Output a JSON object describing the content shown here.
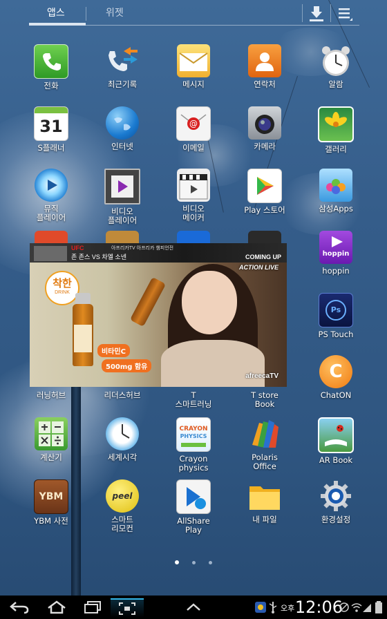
{
  "tabs": {
    "apps": "앱스",
    "widgets": "위젯"
  },
  "apps": [
    {
      "label": "전화",
      "icon": "phone-icon"
    },
    {
      "label": "최근기록",
      "icon": "call-log-icon"
    },
    {
      "label": "메시지",
      "icon": "message-icon"
    },
    {
      "label": "연락처",
      "icon": "contacts-icon"
    },
    {
      "label": "알람",
      "icon": "alarm-clock-icon"
    },
    {
      "label": "S플래너",
      "icon": "calendar-icon",
      "badge": "31"
    },
    {
      "label": "인터넷",
      "icon": "globe-icon"
    },
    {
      "label": "이메일",
      "icon": "email-icon"
    },
    {
      "label": "카메라",
      "icon": "camera-icon"
    },
    {
      "label": "갤러리",
      "icon": "gallery-icon"
    },
    {
      "label": "뮤직\n플레이어",
      "icon": "music-player-icon"
    },
    {
      "label": "비디오\n플레이어",
      "icon": "video-player-icon"
    },
    {
      "label": "비디오\n메이커",
      "icon": "video-maker-icon"
    },
    {
      "label": "Play 스토어",
      "icon": "play-store-icon"
    },
    {
      "label": "삼성Apps",
      "icon": "samsung-apps-icon"
    },
    {
      "label": "hoppin",
      "icon": "hoppin-icon",
      "badge": "hoppin"
    },
    {
      "label": "PS Touch",
      "icon": "ps-touch-icon",
      "badge": "Ps"
    },
    {
      "label": "러닝허브",
      "icon": "learning-hub-icon"
    },
    {
      "label": "리더스허브",
      "icon": "readers-hub-icon"
    },
    {
      "label": "T\n스마트러닝",
      "icon": "t-smart-learning-icon"
    },
    {
      "label": "T store\nBook",
      "icon": "t-store-book-icon"
    },
    {
      "label": "ChatON",
      "icon": "chaton-icon"
    },
    {
      "label": "계산기",
      "icon": "calculator-icon"
    },
    {
      "label": "세계시각",
      "icon": "world-clock-icon"
    },
    {
      "label": "Crayon\nphysics",
      "icon": "crayon-physics-icon"
    },
    {
      "label": "Polaris\nOffice",
      "icon": "polaris-office-icon"
    },
    {
      "label": "AR Book",
      "icon": "ar-book-icon"
    },
    {
      "label": "YBM 사전",
      "icon": "ybm-dictionary-icon",
      "badge": "YBM"
    },
    {
      "label": "스마트\n리모컨",
      "icon": "smart-remote-icon"
    },
    {
      "label": "AllShare\nPlay",
      "icon": "allshare-play-icon"
    },
    {
      "label": "내 파일",
      "icon": "my-files-icon"
    },
    {
      "label": "환경설정",
      "icon": "settings-icon"
    }
  ],
  "video_overlay": {
    "top_banner_brand": "UFC",
    "top_banner_small": "아프리카TV 아프리카 챔피언전",
    "top_banner_match": "존 존스 VS 차엘 소넨",
    "coming_up": "COMING UP",
    "corner_logo": "ACTION LIVE",
    "product_brand": "착한",
    "product_sub": "DRINK",
    "promo_1": "비타민C",
    "promo_2": "500mg 함유",
    "watermark": "afreecaTV"
  },
  "page_indicator": {
    "count": 3,
    "active": 0
  },
  "status_bar": {
    "ampm": "오후",
    "time": "12:06"
  },
  "colors": {
    "wallpaper": "#355d8a",
    "navbar": "#000000",
    "tab_underline": "#dbe5f0"
  }
}
